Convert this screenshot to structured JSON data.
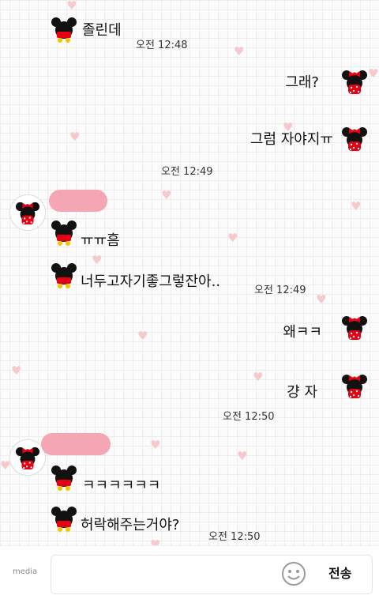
{
  "messages": [
    {
      "text": "졸린데",
      "time": "오전 12:48"
    },
    {
      "text": "그래?"
    },
    {
      "text": "그럼 자야지ㅠ",
      "time": "오전 12:49"
    },
    {
      "text": "ㅠㅠ흠"
    },
    {
      "text": "너두고자기좋그렇잔아..",
      "time": "오전 12:49"
    },
    {
      "text": "왜ㅋㅋ"
    },
    {
      "text": "걍 자",
      "time": "오전 12:50"
    },
    {
      "text": "ㅋㅋㅋㅋㅋㅋ"
    },
    {
      "text": "허락해주는거야?",
      "time": "오전 12:50"
    }
  ],
  "input_bar": {
    "media_label": "media",
    "send_label": "전송"
  },
  "colors": {
    "accent_pink": "#f4a6b5",
    "heart": "#f6c9cd",
    "icon_red": "#e60012",
    "icon_yellow": "#f5c400"
  }
}
